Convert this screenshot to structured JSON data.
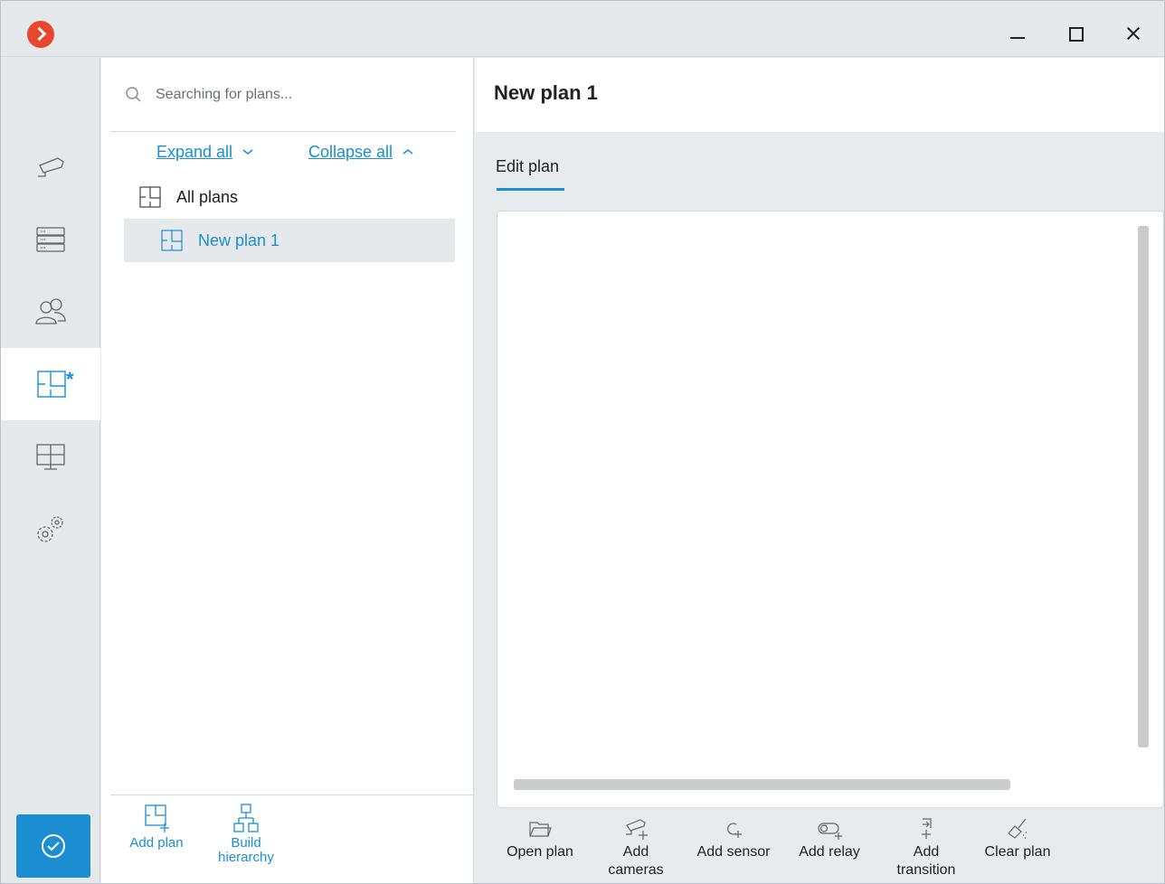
{
  "titlebar": {
    "logo_icon": "app-logo-icon",
    "buttons": [
      "minimize-icon",
      "maximize-icon",
      "close-icon"
    ]
  },
  "nav": {
    "items": [
      {
        "name": "cameras",
        "icon": "camera-icon"
      },
      {
        "name": "servers",
        "icon": "server-icon"
      },
      {
        "name": "users",
        "icon": "users-icon"
      },
      {
        "name": "plans",
        "icon": "plan-icon",
        "active": true,
        "modified_mark": "*"
      },
      {
        "name": "monitors",
        "icon": "monitor-icon"
      },
      {
        "name": "settings",
        "icon": "gears-icon"
      }
    ],
    "apply_icon": "checkmark-circle-icon"
  },
  "plans_panel": {
    "search": {
      "placeholder": "Searching for plans...",
      "value": ""
    },
    "expand_all": "Expand all",
    "collapse_all": "Collapse all",
    "tree": {
      "root": "All plans",
      "children": [
        "New plan 1"
      ]
    },
    "footer": {
      "add_plan": "Add plan",
      "build_hierarchy_line1": "Build",
      "build_hierarchy_line2": "hierarchy"
    }
  },
  "main": {
    "title": "New plan 1",
    "tab": "Edit plan",
    "toolbar": {
      "open_plan": "Open plan",
      "add_cameras_1": "Add",
      "add_cameras_2": "cameras",
      "add_sensor": "Add sensor",
      "add_relay": "Add relay",
      "add_transition_1": "Add",
      "add_transition_2": "transition",
      "clear_plan": "Clear plan"
    }
  },
  "colors": {
    "accent": "#1a8ed1",
    "logo": "#e8472d",
    "sidebar_bg": "#e6e9ec",
    "selected_row": "#e6e9ec"
  }
}
